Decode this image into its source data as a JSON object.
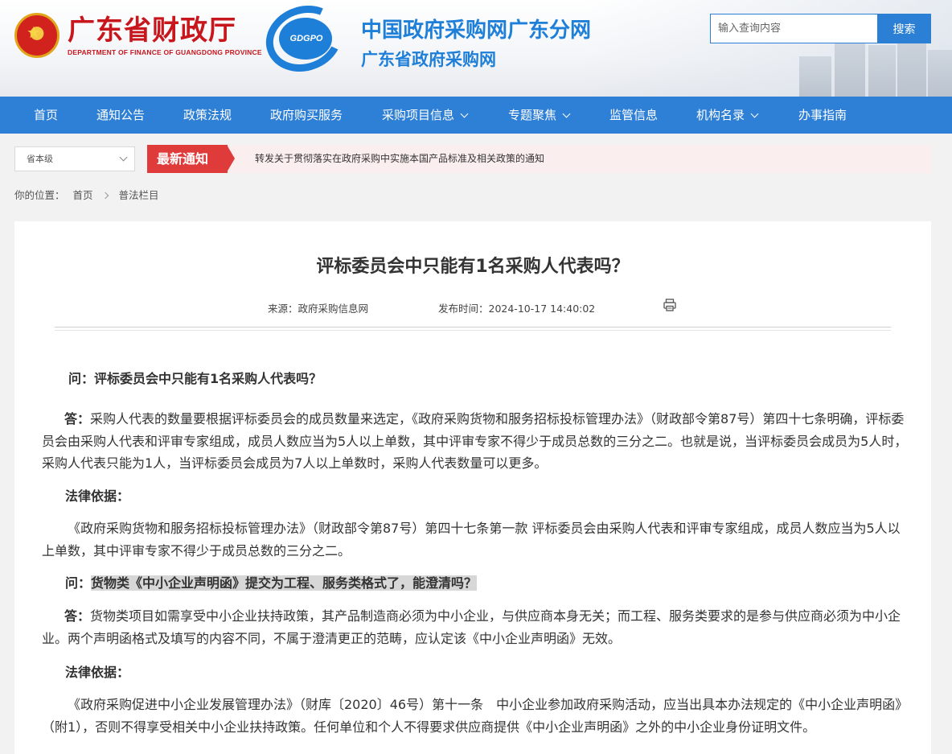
{
  "header": {
    "dept_name_cn": "广东省财政厅",
    "dept_name_en": "DEPARTMENT OF FINANCE OF GUANGDONG PROVINCE",
    "logo_text": "GDGPO",
    "site_title_1": "中国政府采购网广东分网",
    "site_title_2": "广东省政府采购网",
    "search_placeholder": "输入查询内容",
    "search_button": "搜索"
  },
  "nav": {
    "items": [
      {
        "label": "首页",
        "has_dropdown": false
      },
      {
        "label": "通知公告",
        "has_dropdown": false
      },
      {
        "label": "政策法规",
        "has_dropdown": false
      },
      {
        "label": "政府购买服务",
        "has_dropdown": false
      },
      {
        "label": "采购项目信息",
        "has_dropdown": true
      },
      {
        "label": "专题聚焦",
        "has_dropdown": true
      },
      {
        "label": "监管信息",
        "has_dropdown": false
      },
      {
        "label": "机构名录",
        "has_dropdown": true
      },
      {
        "label": "办事指南",
        "has_dropdown": false
      }
    ]
  },
  "notice": {
    "level_select": "省本级",
    "badge": "最新通知",
    "text": "转发关于贯彻落实在政府采购中实施本国产品标准及相关政策的通知"
  },
  "breadcrumb": {
    "prefix": "你的位置：",
    "home": "首页",
    "current": "普法栏目"
  },
  "article": {
    "title": "评标委员会中只能有1名采购人代表吗？",
    "source": "来源：政府采购信息网",
    "publish_time": "发布时间：2024-10-17 14:40:02",
    "q1_label": "问：",
    "q1_text": "评标委员会中只能有1名采购人代表吗？",
    "a1_label": "答：",
    "a1_text": "采购人代表的数量要根据评标委员会的成员数量来选定，《政府采购货物和服务招标投标管理办法》（财政部令第87号）第四十七条明确，评标委员会由采购人代表和评审专家组成，成员人数应当为5人以上单数，其中评审专家不得少于成员总数的三分之二。也就是说，当评标委员会成员为5人时，采购人代表只能为1人，当评标委员会成员为7人以上单数时，采购人代表数量可以更多。",
    "basis1_label": "法律依据：",
    "basis1_text": "《政府采购货物和服务招标投标管理办法》（财政部令第87号）第四十七条第一款 评标委员会由采购人代表和评审专家组成，成员人数应当为5人以上单数，其中评审专家不得少于成员总数的三分之二。",
    "q2_label": "问：",
    "q2_text": "货物类《中小企业声明函》提交为工程、服务类格式了，能澄清吗？",
    "a2_label": "答：",
    "a2_text": "货物类项目如需享受中小企业扶持政策，其产品制造商必须为中小企业，与供应商本身无关；而工程、服务类要求的是参与供应商必须为中小企业。两个声明函格式及填写的内容不同，不属于澄清更正的范畴，应认定该《中小企业声明函》无效。",
    "basis2_label": "法律依据：",
    "basis2_text": "《政府采购促进中小企业发展管理办法》（财库〔2020〕46号）第十一条　中小企业参加政府采购活动，应当出具本办法规定的《中小企业声明函》（附1），否则不得享受相关中小企业扶持政策。任何单位和个人不得要求供应商提供《中小企业声明函》之外的中小企业身份证明文件。"
  },
  "colors": {
    "nav_blue": "#2e7fd6",
    "brand_red": "#c8161d",
    "notice_red": "#e03b3b"
  }
}
